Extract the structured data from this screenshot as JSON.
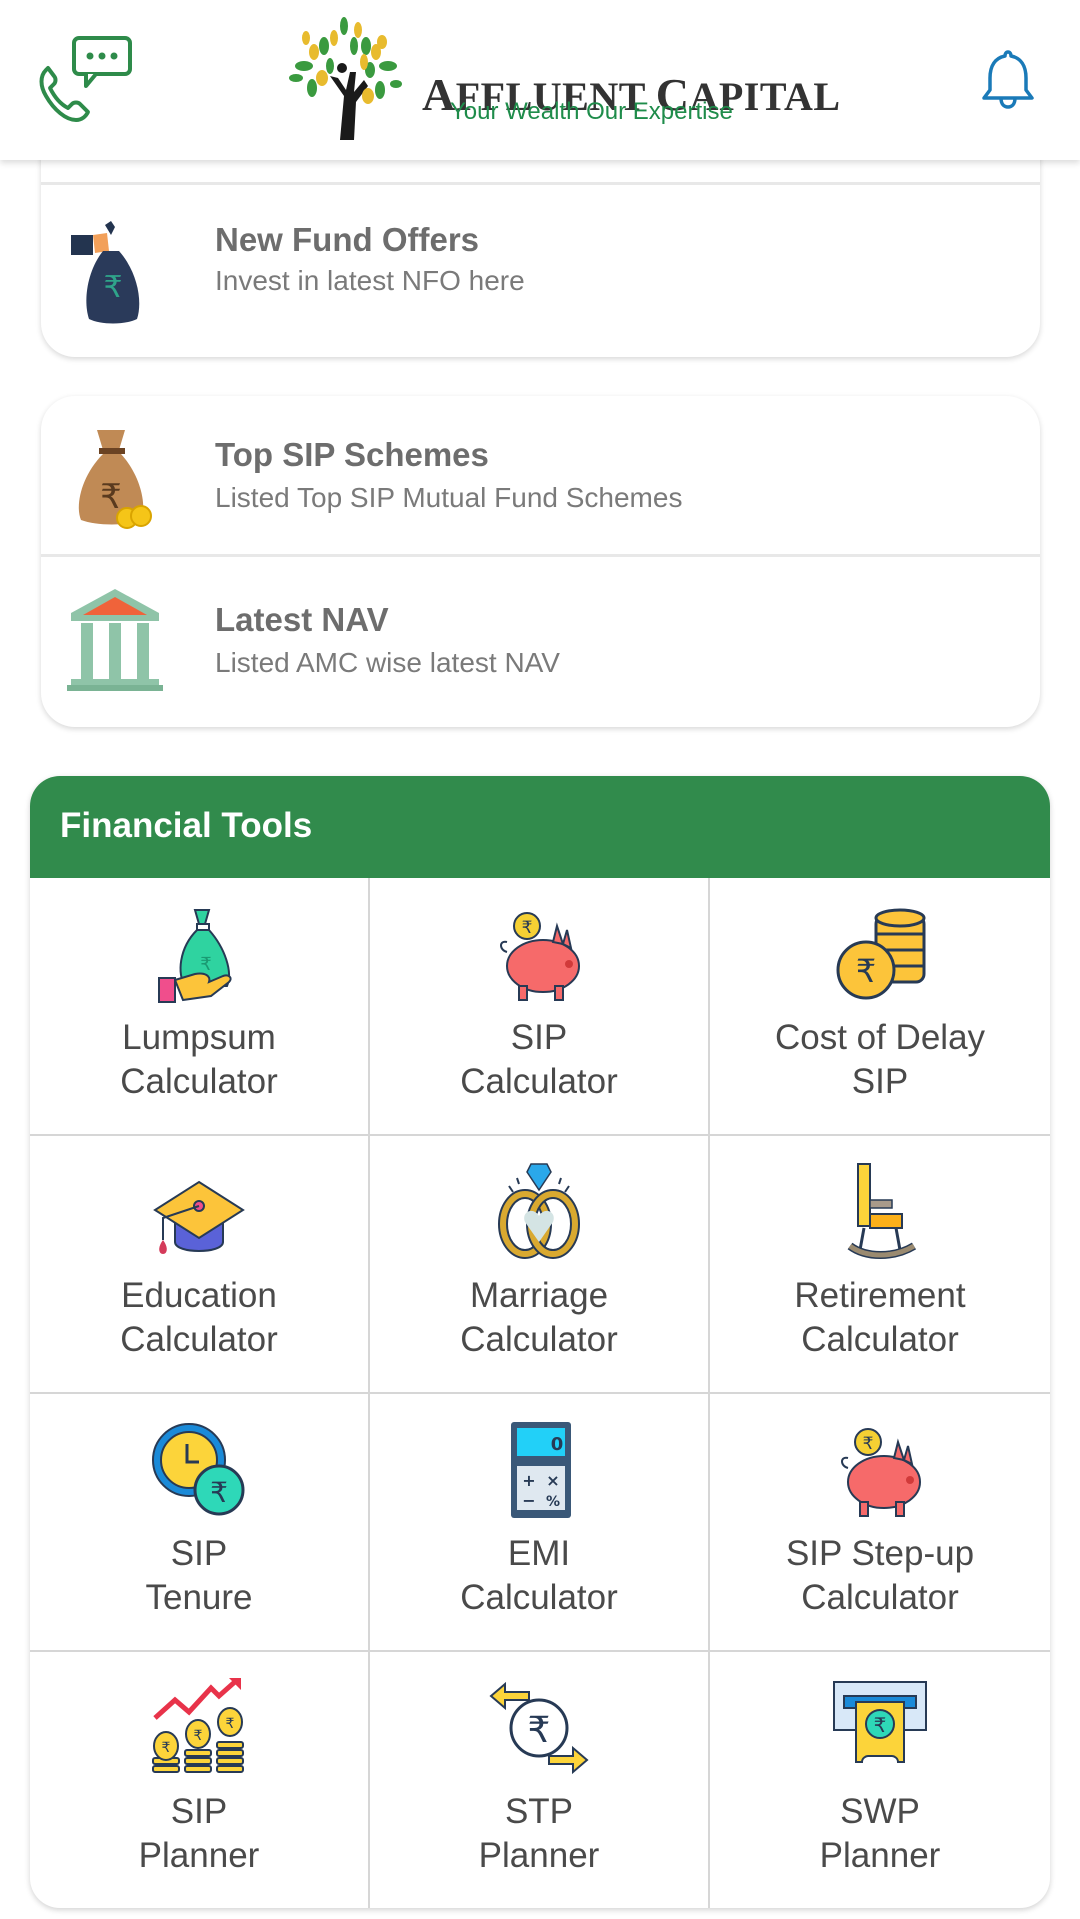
{
  "header": {
    "contact_icon": "phone-chat-icon",
    "logo": {
      "name": "Affluent Capital",
      "name_display": [
        "A",
        "FFLUENT ",
        "C",
        "APITAL"
      ],
      "tagline": "Your Wealth Our Expertise"
    },
    "notification_icon": "bell-icon",
    "colors": {
      "contact_icon": "#2e8b4a",
      "bell_icon": "#1a7ab8"
    }
  },
  "cards": [
    {
      "items": [
        {
          "icon": "money-bag-hand-icon",
          "title": "New Fund Offers",
          "subtitle": "Invest in latest NFO here"
        }
      ]
    },
    {
      "items": [
        {
          "icon": "rupee-sack-coins-icon",
          "title": "Top SIP Schemes",
          "subtitle": "Listed Top SIP Mutual Fund Schemes"
        },
        {
          "icon": "bank-building-icon",
          "title": "Latest NAV",
          "subtitle": "Listed AMC wise latest NAV"
        }
      ]
    }
  ],
  "financial_tools": {
    "title": "Financial Tools",
    "accent_color": "#318b4c",
    "tools": [
      {
        "icon": "money-bag-hand-icon",
        "line1": "Lumpsum",
        "line2": "Calculator"
      },
      {
        "icon": "piggy-bank-icon",
        "line1": "SIP",
        "line2": "Calculator"
      },
      {
        "icon": "coin-stack-icon",
        "line1": "Cost of Delay",
        "line2": "SIP"
      },
      {
        "icon": "graduation-cap-icon",
        "line1": "Education",
        "line2": "Calculator"
      },
      {
        "icon": "wedding-rings-icon",
        "line1": "Marriage",
        "line2": "Calculator"
      },
      {
        "icon": "rocking-chair-icon",
        "line1": "Retirement",
        "line2": "Calculator"
      },
      {
        "icon": "clock-rupee-icon",
        "line1": "SIP",
        "line2": "Tenure"
      },
      {
        "icon": "calculator-icon",
        "line1": "EMI",
        "line2": "Calculator"
      },
      {
        "icon": "piggy-bank-icon",
        "line1": "SIP Step-up",
        "line2": "Calculator"
      },
      {
        "icon": "growth-coins-icon",
        "line1": "SIP",
        "line2": "Planner"
      },
      {
        "icon": "rupee-transfer-icon",
        "line1": "STP",
        "line2": "Planner"
      },
      {
        "icon": "atm-withdrawal-icon",
        "line1": "SWP",
        "line2": "Planner"
      }
    ]
  }
}
